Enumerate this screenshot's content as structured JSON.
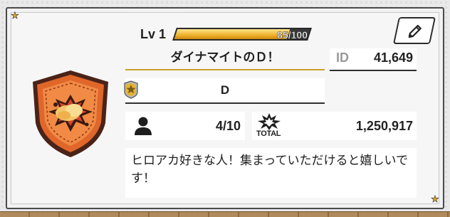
{
  "profile": {
    "level_label": "Lv 1",
    "exp_text": "85/100",
    "exp_fraction": 0.85,
    "name": "ダイナマイトのＤ！",
    "id_label": "ID",
    "id_value": "41,649",
    "guild_name": "D",
    "members_value": "4/10",
    "total_label": "TOTAL",
    "total_value": "1,250,917",
    "comment": "ヒロアカ好きな人！集まっていただけると嬉しいです！"
  },
  "icons": {
    "edit": "pencil-icon",
    "guild": "guild-badge-icon",
    "members": "person-icon",
    "total": "burst-icon",
    "emblem": "explosion-shield-emblem"
  },
  "colors": {
    "accent_gold": "#c9a12a",
    "exp_fill": "#e9a821",
    "emblem_orange": "#e0662a"
  }
}
